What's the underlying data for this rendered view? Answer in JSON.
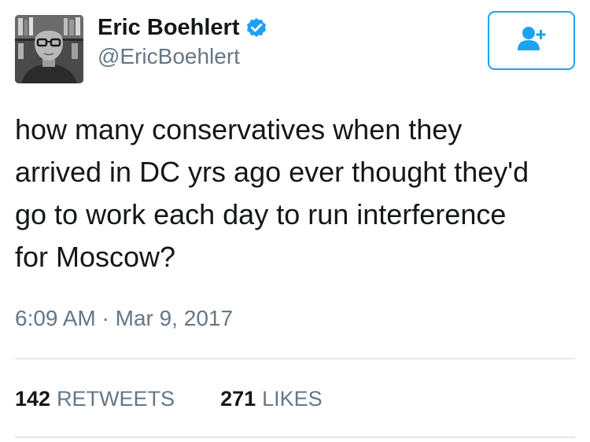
{
  "user": {
    "display_name": "Eric Boehlert",
    "handle": "@EricBoehlert",
    "verified": true
  },
  "follow_button": {
    "icon": "add-user-icon"
  },
  "tweet": {
    "text": "how many conservatives when they\narrived in DC yrs ago ever thought they'd\ngo to work each day to run interference\nfor Moscow?",
    "timestamp": "6:09 AM · Mar 9, 2017"
  },
  "stats": {
    "retweets_count": "142",
    "retweets_label": "RETWEETS",
    "likes_count": "271",
    "likes_label": "LIKES"
  },
  "colors": {
    "accent": "#1da1f2",
    "text": "#14171a",
    "secondary": "#657786",
    "divider": "#e1e8ed"
  }
}
